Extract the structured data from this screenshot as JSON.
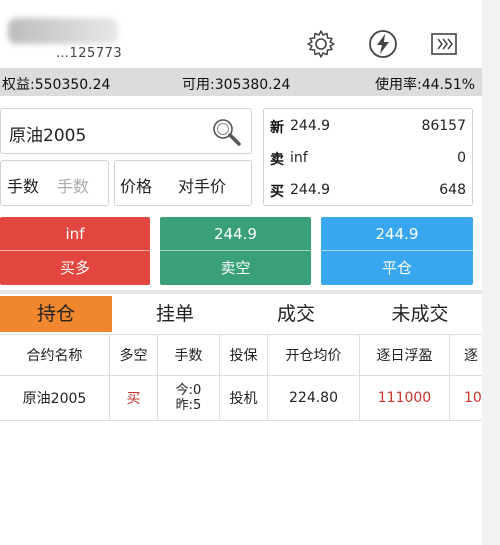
{
  "header": {
    "account_number_partial": "…125773",
    "icons": [
      "gear-icon",
      "lightning-icon",
      "forward-icon"
    ]
  },
  "account_bar": {
    "equity": "权益:550350.24",
    "available": "可用:305380.24",
    "usage": "使用率:44.51%"
  },
  "order": {
    "symbol": "原油2005",
    "qty_label": "手数",
    "qty_placeholder": "手数",
    "price_label": "价格",
    "price_value": "对手价"
  },
  "quote": {
    "rows": [
      {
        "key": "新",
        "value": "244.9",
        "num": "86157"
      },
      {
        "key": "卖",
        "value": "inf",
        "num": "0"
      },
      {
        "key": "买",
        "value": "244.9",
        "num": "648"
      }
    ]
  },
  "actions": {
    "buy": {
      "price": "inf",
      "label": "买多"
    },
    "sell": {
      "price": "244.9",
      "label": "卖空"
    },
    "close": {
      "price": "244.9",
      "label": "平仓"
    }
  },
  "tabs": [
    "持仓",
    "挂单",
    "成交",
    "未成交"
  ],
  "active_tab": "持仓",
  "table": {
    "headers": [
      "合约名称",
      "多空",
      "手数",
      "投保",
      "开仓均价",
      "逐日浮盈",
      "逐"
    ],
    "rows": [
      {
        "name": "原油2005",
        "side": "买",
        "qty_today": "今:0",
        "qty_prev": "昨:5",
        "hedge": "投机",
        "avg_price": "224.80",
        "float_pnl": "111000",
        "extra": "10"
      }
    ]
  },
  "colors": {
    "red": "#e2463e",
    "green": "#3aa07a",
    "blue": "#39a7ef",
    "active_tab": "#f0872e"
  }
}
